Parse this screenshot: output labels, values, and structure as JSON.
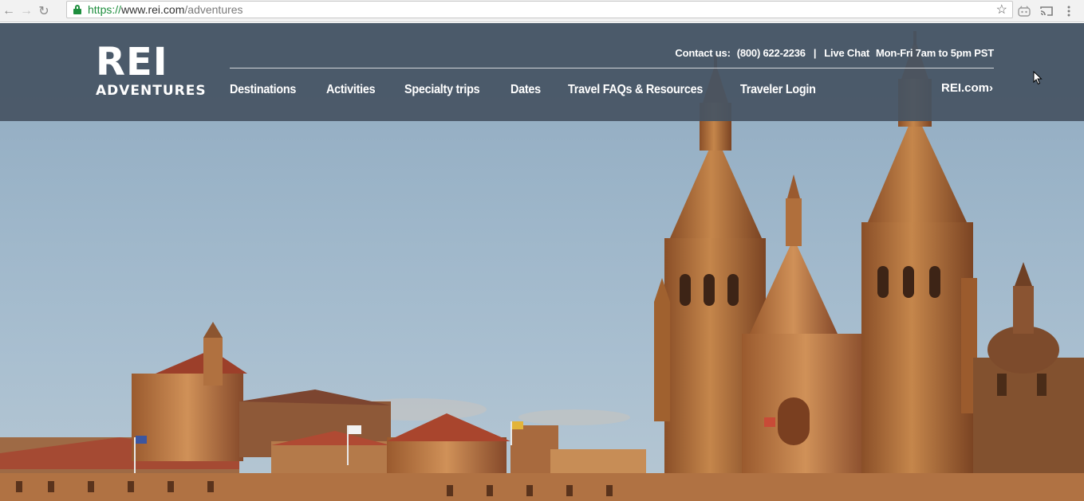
{
  "browser": {
    "url_scheme": "https://",
    "url_host": "www.rei.com",
    "url_path": "/adventures",
    "icons": [
      "back-arrow-icon",
      "forward-arrow-icon",
      "reload-icon",
      "lock-icon",
      "star-icon",
      "extension-icon",
      "cast-icon",
      "menu-dots-icon"
    ]
  },
  "header": {
    "logo_line1": "REI",
    "logo_line2": "ADVENTURES",
    "contact_label": "Contact us:",
    "phone": "(800) 622-2236",
    "separator": "|",
    "live_chat": "Live Chat",
    "hours": "Mon-Fri 7am to 5pm PST",
    "nav": [
      {
        "label": "Destinations"
      },
      {
        "label": "Activities"
      },
      {
        "label": "Specialty trips"
      },
      {
        "label": "Dates"
      },
      {
        "label": "Travel FAQs & Resources"
      },
      {
        "label": "Traveler Login"
      }
    ],
    "reicom_label": "REI.com"
  },
  "colors": {
    "header_bg": "#465463",
    "sky": "#9bb4c8",
    "stone": "#b7743f",
    "roof": "#a3492f",
    "secure_green": "#1e8e3e"
  }
}
